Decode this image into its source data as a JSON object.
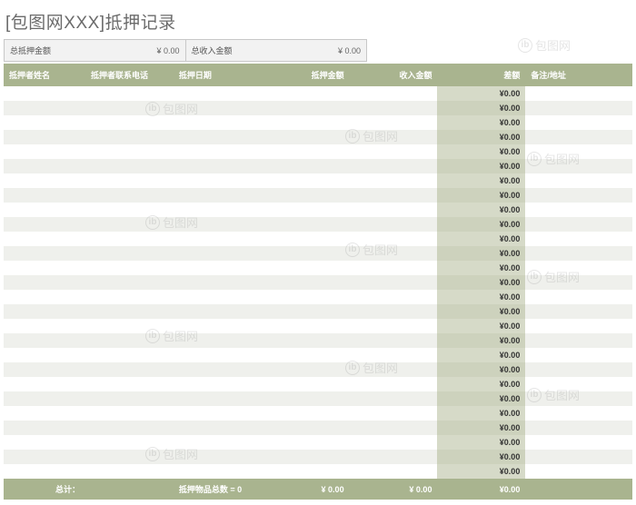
{
  "title": "[包图网XXX]抵押记录",
  "summary": {
    "total_pledge_label": "总抵押金额",
    "total_pledge_value": "¥ 0.00",
    "total_income_label": "总收入金额",
    "total_income_value": "¥ 0.00"
  },
  "headers": {
    "name": "抵押者姓名",
    "phone": "抵押者联系电话",
    "date": "抵押日期",
    "amount": "抵押金额",
    "income": "收入金额",
    "diff": "差额",
    "note": "备注/地址"
  },
  "rows": [
    {
      "name": "",
      "phone": "",
      "date": "",
      "amount": "",
      "income": "",
      "diff": "¥0.00",
      "note": ""
    },
    {
      "name": "",
      "phone": "",
      "date": "",
      "amount": "",
      "income": "",
      "diff": "¥0.00",
      "note": ""
    },
    {
      "name": "",
      "phone": "",
      "date": "",
      "amount": "",
      "income": "",
      "diff": "¥0.00",
      "note": ""
    },
    {
      "name": "",
      "phone": "",
      "date": "",
      "amount": "",
      "income": "",
      "diff": "¥0.00",
      "note": ""
    },
    {
      "name": "",
      "phone": "",
      "date": "",
      "amount": "",
      "income": "",
      "diff": "¥0.00",
      "note": ""
    },
    {
      "name": "",
      "phone": "",
      "date": "",
      "amount": "",
      "income": "",
      "diff": "¥0.00",
      "note": ""
    },
    {
      "name": "",
      "phone": "",
      "date": "",
      "amount": "",
      "income": "",
      "diff": "¥0.00",
      "note": ""
    },
    {
      "name": "",
      "phone": "",
      "date": "",
      "amount": "",
      "income": "",
      "diff": "¥0.00",
      "note": ""
    },
    {
      "name": "",
      "phone": "",
      "date": "",
      "amount": "",
      "income": "",
      "diff": "¥0.00",
      "note": ""
    },
    {
      "name": "",
      "phone": "",
      "date": "",
      "amount": "",
      "income": "",
      "diff": "¥0.00",
      "note": ""
    },
    {
      "name": "",
      "phone": "",
      "date": "",
      "amount": "",
      "income": "",
      "diff": "¥0.00",
      "note": ""
    },
    {
      "name": "",
      "phone": "",
      "date": "",
      "amount": "",
      "income": "",
      "diff": "¥0.00",
      "note": ""
    },
    {
      "name": "",
      "phone": "",
      "date": "",
      "amount": "",
      "income": "",
      "diff": "¥0.00",
      "note": ""
    },
    {
      "name": "",
      "phone": "",
      "date": "",
      "amount": "",
      "income": "",
      "diff": "¥0.00",
      "note": ""
    },
    {
      "name": "",
      "phone": "",
      "date": "",
      "amount": "",
      "income": "",
      "diff": "¥0.00",
      "note": ""
    },
    {
      "name": "",
      "phone": "",
      "date": "",
      "amount": "",
      "income": "",
      "diff": "¥0.00",
      "note": ""
    },
    {
      "name": "",
      "phone": "",
      "date": "",
      "amount": "",
      "income": "",
      "diff": "¥0.00",
      "note": ""
    },
    {
      "name": "",
      "phone": "",
      "date": "",
      "amount": "",
      "income": "",
      "diff": "¥0.00",
      "note": ""
    },
    {
      "name": "",
      "phone": "",
      "date": "",
      "amount": "",
      "income": "",
      "diff": "¥0.00",
      "note": ""
    },
    {
      "name": "",
      "phone": "",
      "date": "",
      "amount": "",
      "income": "",
      "diff": "¥0.00",
      "note": ""
    },
    {
      "name": "",
      "phone": "",
      "date": "",
      "amount": "",
      "income": "",
      "diff": "¥0.00",
      "note": ""
    },
    {
      "name": "",
      "phone": "",
      "date": "",
      "amount": "",
      "income": "",
      "diff": "¥0.00",
      "note": ""
    },
    {
      "name": "",
      "phone": "",
      "date": "",
      "amount": "",
      "income": "",
      "diff": "¥0.00",
      "note": ""
    },
    {
      "name": "",
      "phone": "",
      "date": "",
      "amount": "",
      "income": "",
      "diff": "¥0.00",
      "note": ""
    },
    {
      "name": "",
      "phone": "",
      "date": "",
      "amount": "",
      "income": "",
      "diff": "¥0.00",
      "note": ""
    },
    {
      "name": "",
      "phone": "",
      "date": "",
      "amount": "",
      "income": "",
      "diff": "¥0.00",
      "note": ""
    },
    {
      "name": "",
      "phone": "",
      "date": "",
      "amount": "",
      "income": "",
      "diff": "¥0.00",
      "note": ""
    }
  ],
  "footer": {
    "total_label": "总计：",
    "item_count_label": "抵押物品总数 = 0",
    "amount_total": "¥ 0.00",
    "income_total": "¥ 0.00",
    "diff_total": "¥0.00"
  },
  "watermark_text": "包图网",
  "colors": {
    "header_bg": "#a9b48f",
    "diff_bg": "#d6dac8",
    "row_alt": "#eff0ec"
  }
}
